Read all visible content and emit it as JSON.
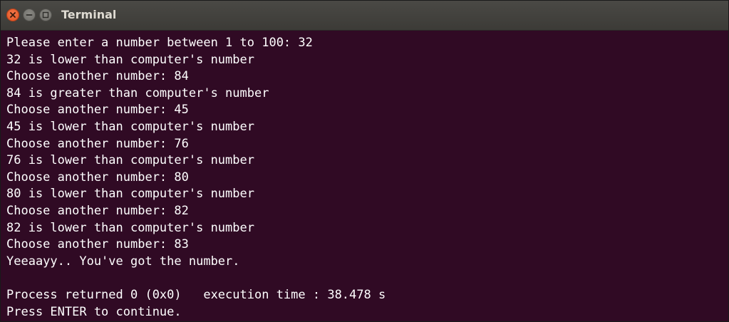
{
  "window": {
    "title": "Terminal"
  },
  "terminal": {
    "lines": [
      "Please enter a number between 1 to 100: 32",
      "32 is lower than computer's number",
      "Choose another number: 84",
      "84 is greater than computer's number",
      "Choose another number: 45",
      "45 is lower than computer's number",
      "Choose another number: 76",
      "76 is lower than computer's number",
      "Choose another number: 80",
      "80 is lower than computer's number",
      "Choose another number: 82",
      "82 is lower than computer's number",
      "Choose another number: 83",
      "Yeeaayy.. You've got the number.",
      "",
      "Process returned 0 (0x0)   execution time : 38.478 s",
      "Press ENTER to continue."
    ]
  },
  "colors": {
    "terminal_background": "#300a24",
    "terminal_text": "#ffffff",
    "titlebar": "#3c3b37",
    "close_button": "#e95420"
  }
}
